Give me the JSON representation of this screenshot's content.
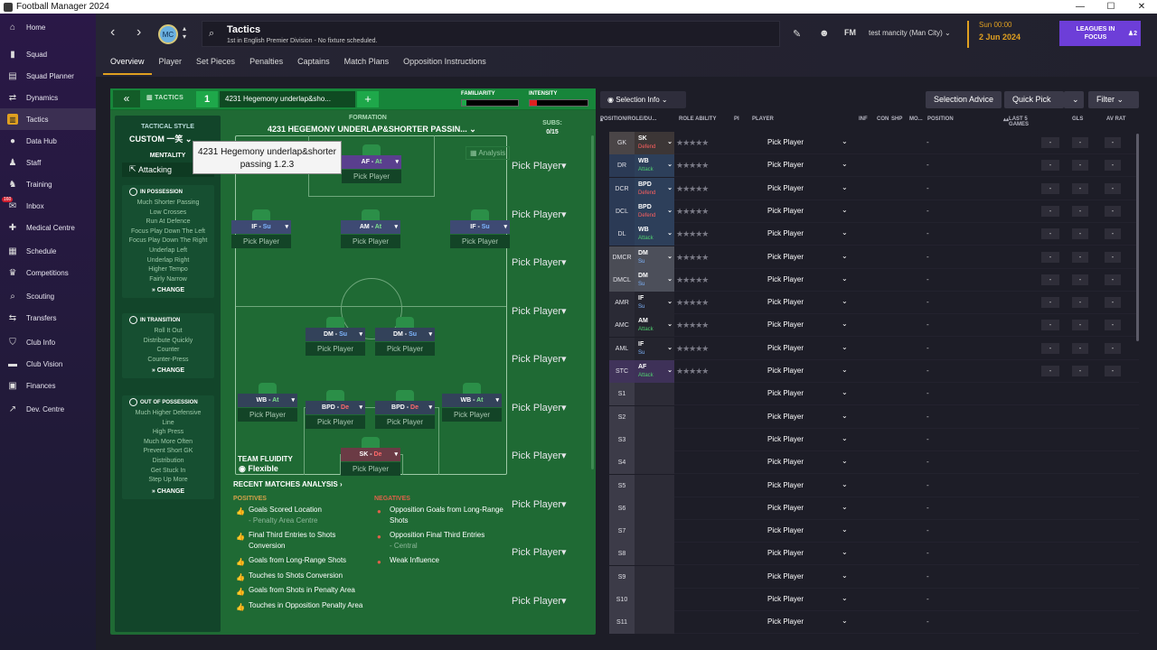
{
  "app": {
    "title": "Football Manager 2024",
    "window_buttons": [
      "—",
      "☐",
      "✕"
    ]
  },
  "sidebar": {
    "items": [
      {
        "label": "Home",
        "icon": "home-icon",
        "glyph": "⌂"
      },
      {
        "label": "Squad",
        "icon": "squad-icon",
        "glyph": "▮"
      },
      {
        "label": "Squad Planner",
        "icon": "planner-icon",
        "glyph": "▤"
      },
      {
        "label": "Dynamics",
        "icon": "dynamics-icon",
        "glyph": "⇄"
      },
      {
        "label": "Tactics",
        "icon": "tactics-icon",
        "glyph": "▥",
        "active": true
      },
      {
        "label": "Data Hub",
        "icon": "data-hub-icon",
        "glyph": "●"
      },
      {
        "label": "Staff",
        "icon": "staff-icon",
        "glyph": "♟"
      },
      {
        "label": "Training",
        "icon": "training-icon",
        "glyph": "♞"
      },
      {
        "label": "Inbox",
        "icon": "inbox-icon",
        "glyph": "✉",
        "badge": "160"
      },
      {
        "label": "Medical Centre",
        "icon": "medical-icon",
        "glyph": "✚"
      },
      {
        "label": "Schedule",
        "icon": "schedule-icon",
        "glyph": "▦"
      },
      {
        "label": "Competitions",
        "icon": "trophy-icon",
        "glyph": "♛"
      },
      {
        "label": "Scouting",
        "icon": "scouting-icon",
        "glyph": "⌕"
      },
      {
        "label": "Transfers",
        "icon": "transfers-icon",
        "glyph": "⇆"
      },
      {
        "label": "Club Info",
        "icon": "club-info-icon",
        "glyph": "⛉"
      },
      {
        "label": "Club Vision",
        "icon": "club-vision-icon",
        "glyph": "▬"
      },
      {
        "label": "Finances",
        "icon": "finances-icon",
        "glyph": "▣"
      },
      {
        "label": "Dev. Centre",
        "icon": "dev-centre-icon",
        "glyph": "↗"
      }
    ]
  },
  "header": {
    "nav_back": "‹",
    "nav_forward": "›",
    "crest": "MC",
    "title": "Tactics",
    "subtitle": "1st in English Premier Division - No fixture scheduled.",
    "manager": "test mancity (Man City)",
    "fm_label": "FM",
    "date_time": "Sun 00:00",
    "date": "2 Jun 2024",
    "leagues_button": "LEAGUES IN FOCUS",
    "leagues_count": "2"
  },
  "tabs": [
    "Overview",
    "Player",
    "Set Pieces",
    "Penalties",
    "Captains",
    "Match Plans",
    "Opposition Instructions"
  ],
  "tactic_bar": {
    "back": "«",
    "label": "TACTICS",
    "number": "1",
    "name": "4231 Hegemony underlap&sho...",
    "add": "+",
    "familiarity_label": "FAMILIARITY",
    "familiarity": 0.08,
    "intensity_label": "INTENSITY",
    "intensity": 0.12,
    "accent_green": "#1ea84a",
    "accent_red": "#e02020"
  },
  "tactical_style": {
    "title": "TACTICAL STYLE",
    "value": "CUSTOM 一笑",
    "mentality_label": "MENTALITY",
    "mentality": "Attacking",
    "in_possession": {
      "title": "IN POSSESSION",
      "items": [
        "Much Shorter Passing",
        "Low Crosses",
        "Run At Defence",
        "Focus Play Down The Left",
        "Focus Play Down The Right",
        "Underlap Left",
        "Underlap Right",
        "Higher Tempo",
        "Fairly Narrow"
      ],
      "change": "CHANGE"
    },
    "in_transition": {
      "title": "IN TRANSITION",
      "items": [
        "Roll It Out",
        "Distribute Quickly",
        "Counter",
        "Counter-Press"
      ],
      "change": "CHANGE"
    },
    "out_of_possession": {
      "title": "OUT OF POSSESSION",
      "items": [
        "Much Higher Defensive",
        "Line",
        "High Press",
        "Much More Often",
        "Prevent Short GK",
        "Distribution",
        "Get Stuck In",
        "Step Up More"
      ],
      "change": "CHANGE"
    },
    "fluidity_label": "TEAM FLUIDITY",
    "fluidity": "Flexible"
  },
  "formation": {
    "label": "FORMATION",
    "name": "4231 HEGEMONY UNDERLAP&SHORTER PASSIN...",
    "analysis": "Analysis",
    "subs_label": "SUBS:",
    "subs": "0/15"
  },
  "pitch_players": [
    {
      "role": "AF",
      "duty": "At",
      "pick": "Pick Player",
      "kind": "att"
    },
    {
      "role": "IF",
      "duty": "Su",
      "pick": "Pick Player",
      "kind": "att"
    },
    {
      "role": "AM",
      "duty": "At",
      "pick": "Pick Player",
      "kind": "att"
    },
    {
      "role": "IF",
      "duty": "Su",
      "pick": "Pick Player",
      "kind": "att"
    },
    {
      "role": "DM",
      "duty": "Su",
      "pick": "Pick Player",
      "kind": "mid"
    },
    {
      "role": "DM",
      "duty": "Su",
      "pick": "Pick Player",
      "kind": "mid"
    },
    {
      "role": "WB",
      "duty": "At",
      "pick": "Pick Player",
      "kind": "def"
    },
    {
      "role": "BPD",
      "duty": "De",
      "pick": "Pick Player",
      "kind": "def"
    },
    {
      "role": "BPD",
      "duty": "De",
      "pick": "Pick Player",
      "kind": "def"
    },
    {
      "role": "WB",
      "duty": "At",
      "pick": "Pick Player",
      "kind": "def"
    },
    {
      "role": "SK",
      "duty": "De",
      "pick": "Pick Player",
      "kind": "gk"
    }
  ],
  "subs_slots": [
    "Pick Player",
    "Pick Player",
    "Pick Player",
    "Pick Player",
    "Pick Player",
    "Pick Player",
    "Pick Player",
    "Pick Player",
    "Pick Player",
    "Pick Player"
  ],
  "analysis": {
    "title": "RECENT MATCHES ANALYSIS ›",
    "positives_label": "POSITIVES",
    "negatives_label": "NEGATIVES",
    "positives": [
      {
        "text": "Goals Scored Location",
        "sub": "- Penalty Area Centre"
      },
      {
        "text": "Final Third Entries to Shots Conversion",
        "sub": ""
      },
      {
        "text": "Goals from Long-Range Shots",
        "sub": ""
      },
      {
        "text": "Touches to Shots Conversion",
        "sub": ""
      },
      {
        "text": "Goals from Shots in Penalty Area",
        "sub": ""
      },
      {
        "text": "Touches in Opposition Penalty Area",
        "sub": ""
      }
    ],
    "negatives": [
      {
        "text": "Opposition Goals from Long-Range Shots",
        "sub": ""
      },
      {
        "text": "Opposition Final Third Entries",
        "sub": "- Central"
      },
      {
        "text": "Weak Influence",
        "sub": ""
      }
    ]
  },
  "tooltip": "4231 Hegemony underlap&shorter passing 1.2.3",
  "selection": {
    "info_button": "Selection Info",
    "advice_button": "Selection Advice",
    "quick_pick": "Quick Pick",
    "filter": "Filter"
  },
  "table": {
    "headers": [
      "POSITION/ROLE/DU...",
      "ROLE ABILITY",
      "PI",
      "PLAYER",
      "INF",
      "CON",
      "SHP",
      "MO...",
      "POSITION",
      "LAST 5 GAMES",
      "GLS",
      "AV RAT"
    ],
    "pick": "Pick Player",
    "dash": "-",
    "rows": [
      {
        "pos": "GK",
        "role": "SK",
        "duty": "Defend",
        "type": "gk"
      },
      {
        "pos": "DR",
        "role": "WB",
        "duty": "Attack",
        "type": "def"
      },
      {
        "pos": "DCR",
        "role": "BPD",
        "duty": "Defend",
        "type": "def"
      },
      {
        "pos": "DCL",
        "role": "BPD",
        "duty": "Defend",
        "type": "def"
      },
      {
        "pos": "DL",
        "role": "WB",
        "duty": "Attack",
        "type": "def"
      },
      {
        "pos": "DMCR",
        "role": "DM",
        "duty": "Su",
        "type": "dm"
      },
      {
        "pos": "DMCL",
        "role": "DM",
        "duty": "Su",
        "type": "dm"
      },
      {
        "pos": "AMR",
        "role": "IF",
        "duty": "Su",
        "type": "am"
      },
      {
        "pos": "AMC",
        "role": "AM",
        "duty": "Attack",
        "type": "am"
      },
      {
        "pos": "AML",
        "role": "IF",
        "duty": "Su",
        "type": "am"
      },
      {
        "pos": "STC",
        "role": "AF",
        "duty": "Attack",
        "type": "st"
      },
      {
        "pos": "S1"
      },
      {
        "pos": "S2"
      },
      {
        "pos": "S3"
      },
      {
        "pos": "S4"
      },
      {
        "pos": "S5"
      },
      {
        "pos": "S6"
      },
      {
        "pos": "S7"
      },
      {
        "pos": "S8"
      },
      {
        "pos": "S9"
      },
      {
        "pos": "S10"
      },
      {
        "pos": "S11"
      }
    ]
  }
}
